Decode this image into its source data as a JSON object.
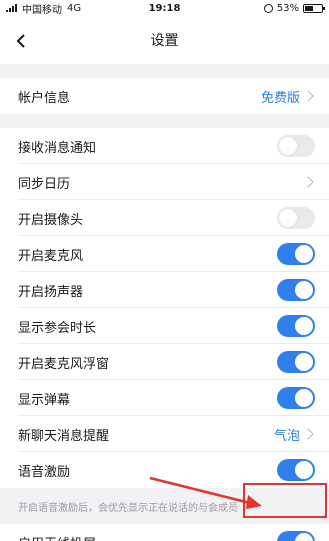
{
  "status_bar": {
    "carrier": "中国移动",
    "network": "4G",
    "time": "19:18",
    "battery_percent": "53%",
    "battery_level": 0.53
  },
  "nav": {
    "title": "设置"
  },
  "account_row": {
    "label": "帐户信息",
    "value": "免费版"
  },
  "settings": [
    {
      "label": "接收消息通知",
      "type": "toggle",
      "on": false
    },
    {
      "label": "同步日历",
      "type": "chevron"
    },
    {
      "label": "开启摄像头",
      "type": "toggle",
      "on": false
    },
    {
      "label": "开启麦克风",
      "type": "toggle",
      "on": true
    },
    {
      "label": "开启扬声器",
      "type": "toggle",
      "on": true
    },
    {
      "label": "显示参会时长",
      "type": "toggle",
      "on": true
    },
    {
      "label": "开启麦克风浮窗",
      "type": "toggle",
      "on": true
    },
    {
      "label": "显示弹幕",
      "type": "toggle",
      "on": true
    },
    {
      "label": "新聊天消息提醒",
      "type": "value",
      "value": "气泡"
    },
    {
      "label": "语音激励",
      "type": "toggle",
      "on": true
    }
  ],
  "hint_text": "开启语音激励后，会优先显示正在说话的与会成员",
  "wireless_row": {
    "label": "启用无线投屏",
    "on": true
  },
  "colors": {
    "accent": "#2f80ed",
    "link": "#2a7de1",
    "highlight": "#e3342f"
  }
}
